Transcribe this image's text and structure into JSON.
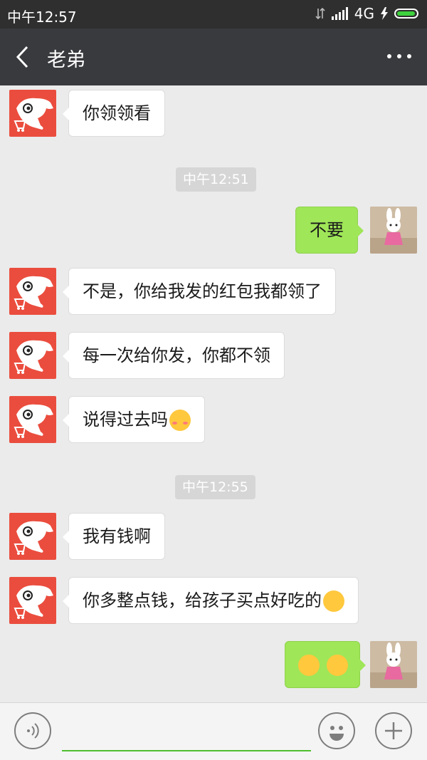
{
  "status_bar": {
    "time": "中午12:57",
    "network": "4G"
  },
  "header": {
    "title": "老弟",
    "back_icon": "back-arrow-icon",
    "more_icon": "more-dots-icon"
  },
  "timestamps": [
    "中午12:51",
    "中午12:55"
  ],
  "messages": [
    {
      "side": "left",
      "text": "你领领看"
    },
    {
      "side": "right",
      "text": "不要"
    },
    {
      "side": "left",
      "text": "不是，你给我发的红包我都领了"
    },
    {
      "side": "left",
      "text": "每一次给你发，你都不领"
    },
    {
      "side": "left",
      "text": "说得过去吗",
      "emoji": "blush-emoji-icon"
    },
    {
      "side": "left",
      "text": "我有钱啊"
    },
    {
      "side": "left",
      "text": "你多整点钱，给孩子买点好吃的",
      "emoji": "drool-emoji-icon"
    },
    {
      "side": "right",
      "text": "",
      "emoji": "laugh-emoji-icon x2"
    }
  ],
  "input": {
    "placeholder": "",
    "voice_icon": "voice-icon",
    "emoji_icon": "emoji-icon",
    "plus_icon": "plus-icon"
  },
  "colors": {
    "header_bg": "#393a3e",
    "status_bg": "#2f2f2f",
    "chat_bg": "#ebebeb",
    "my_bubble": "#9fe658",
    "jd_avatar": "#ea4d3e"
  }
}
